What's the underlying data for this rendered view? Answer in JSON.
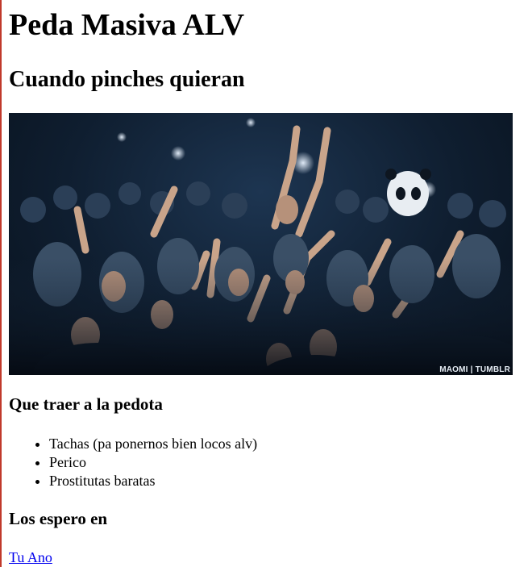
{
  "page": {
    "title": "Peda Masiva ALV",
    "subtitle": "Cuando pinches quieran"
  },
  "hero": {
    "watermark": "MAOMI | TUMBLR"
  },
  "bring_section": {
    "heading": "Que traer a la pedota",
    "items": [
      "Tachas (pa ponernos bien locos alv)",
      "Perico",
      "Prostitutas baratas"
    ]
  },
  "location_section": {
    "heading": "Los espero en",
    "link_text": "Tu Ano"
  },
  "colors": {
    "link": "#0000ee",
    "left_border": "#c0392b",
    "photo_tone": "#1d3551"
  }
}
